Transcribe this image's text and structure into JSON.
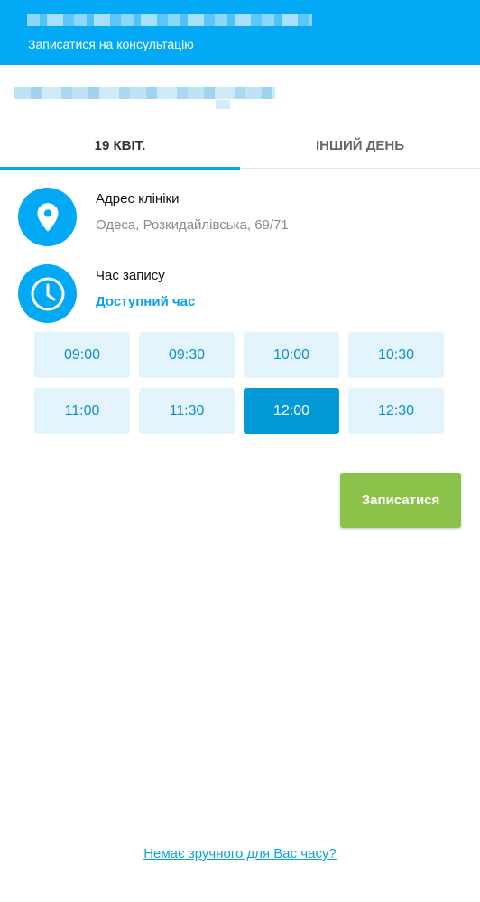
{
  "header": {
    "subtitle": "Записатися на консультацію",
    "background_color": "#03a9f4"
  },
  "tabs": [
    {
      "label": "19 КВІТ.",
      "active": true
    },
    {
      "label": "ІНШИЙ ДЕНЬ",
      "active": false
    }
  ],
  "clinic": {
    "icon": "location-pin-icon",
    "label": "Адрес клініки",
    "address": "Одеса, Розкидайлівська, 69/71"
  },
  "appointment": {
    "icon": "clock-icon",
    "label": "Час запису",
    "availability": "Доступний час"
  },
  "time_slots": [
    {
      "time": "09:00",
      "selected": false
    },
    {
      "time": "09:30",
      "selected": false
    },
    {
      "time": "10:00",
      "selected": false
    },
    {
      "time": "10:30",
      "selected": false
    },
    {
      "time": "11:00",
      "selected": false
    },
    {
      "time": "11:30",
      "selected": false
    },
    {
      "time": "12:00",
      "selected": true
    },
    {
      "time": "12:30",
      "selected": false
    }
  ],
  "submit_label": "Записатися",
  "submit_color": "#8bc34a",
  "no_time_link": "Немає зручного для Вас часу?"
}
